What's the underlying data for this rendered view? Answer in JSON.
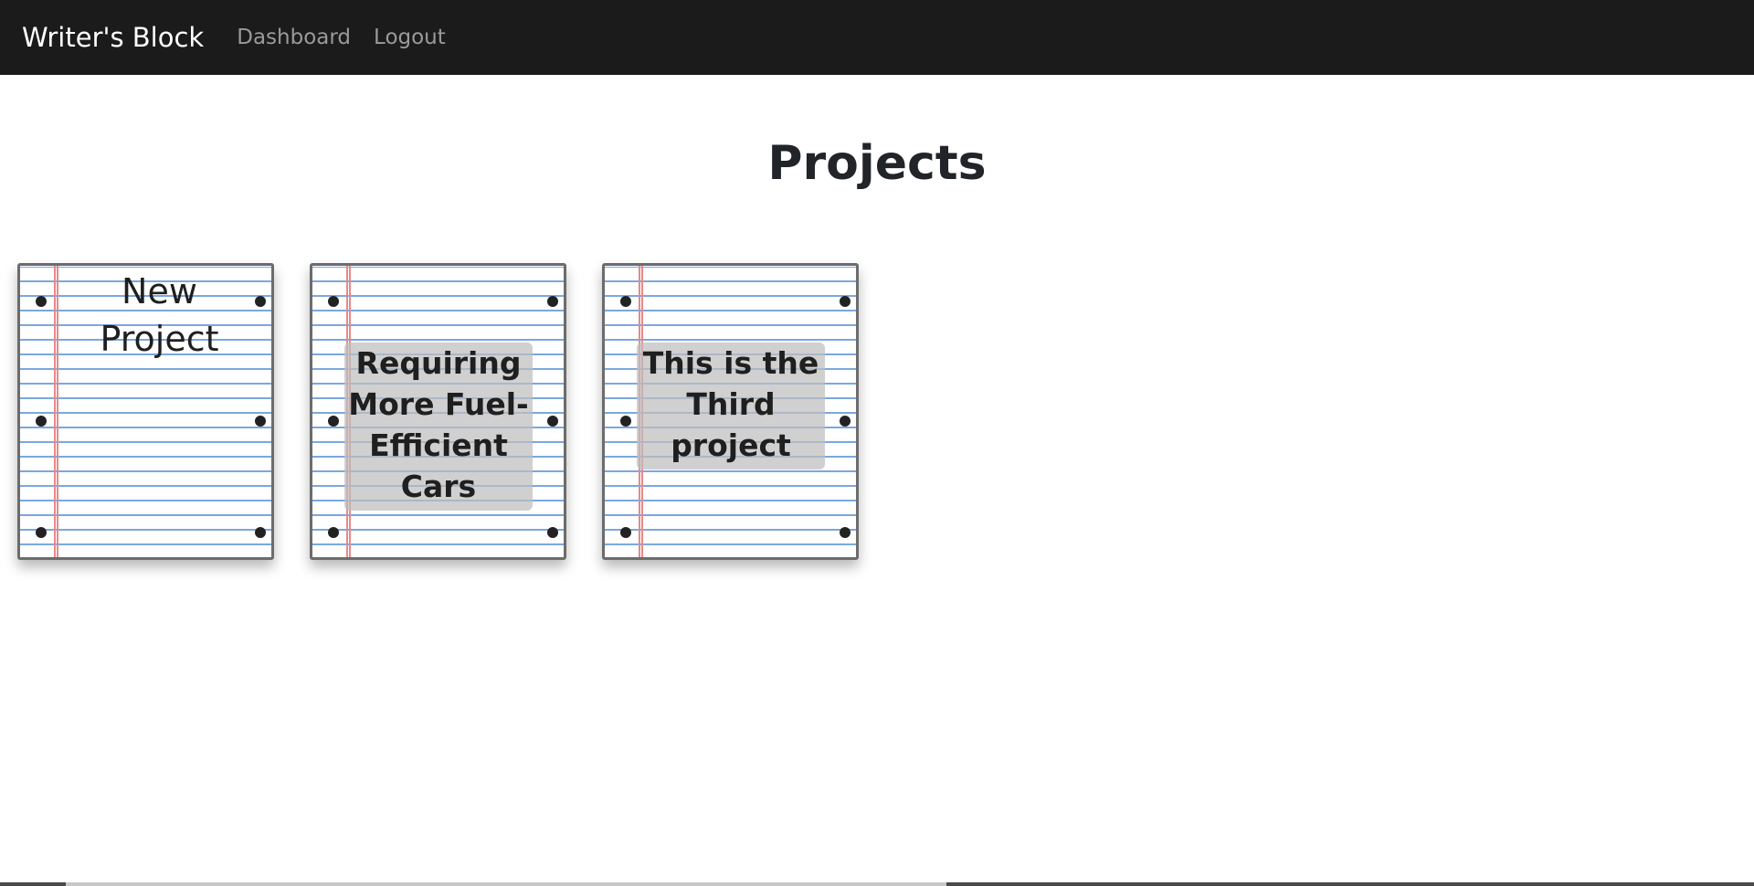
{
  "navbar": {
    "brand": "Writer's Block",
    "links": [
      "Dashboard",
      "Logout"
    ]
  },
  "page": {
    "title": "Projects"
  },
  "cards": [
    {
      "title": "New Project"
    },
    {
      "title": "Requiring More Fuel-Efficient Cars"
    },
    {
      "title": "This is the Third project"
    }
  ],
  "colors": {
    "navbar_bg": "#1b1b1b",
    "notebook_line": "#7aa8de",
    "margin_line": "#e58a8a",
    "title_box": "#bebebe"
  }
}
